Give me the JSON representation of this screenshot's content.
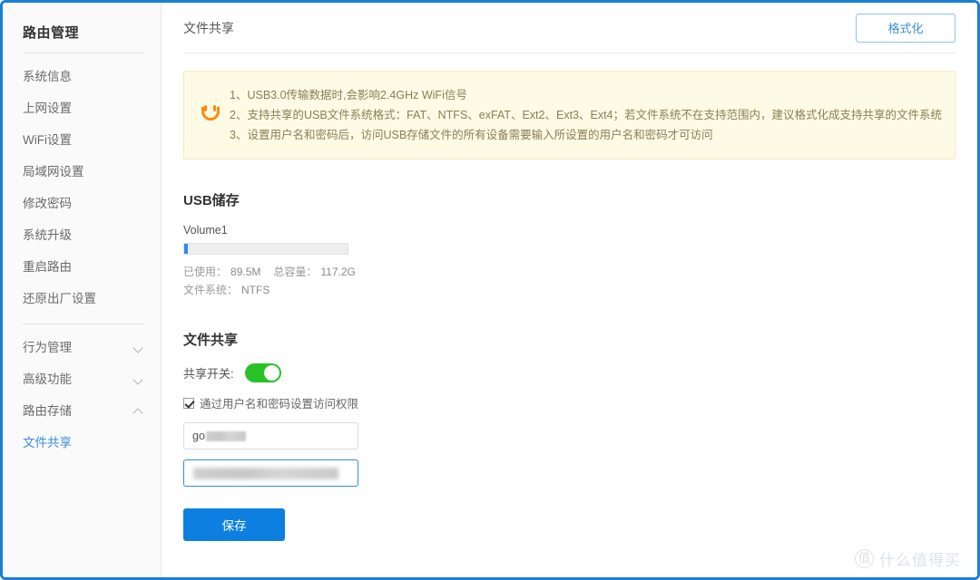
{
  "sidebar": {
    "title": "路由管理",
    "items": [
      {
        "label": "系统信息",
        "type": "link",
        "active": false
      },
      {
        "label": "上网设置",
        "type": "link",
        "active": false
      },
      {
        "label": "WiFi设置",
        "type": "link",
        "active": false
      },
      {
        "label": "局域网设置",
        "type": "link",
        "active": false
      },
      {
        "label": "修改密码",
        "type": "link",
        "active": false
      },
      {
        "label": "系统升级",
        "type": "link",
        "active": false
      },
      {
        "label": "重启路由",
        "type": "link",
        "active": false
      },
      {
        "label": "还原出厂设置",
        "type": "link",
        "active": false
      }
    ],
    "groups": [
      {
        "label": "行为管理",
        "chevron": "chevron-down-icon",
        "expanded": false
      },
      {
        "label": "高级功能",
        "chevron": "chevron-down-icon",
        "expanded": false
      },
      {
        "label": "路由存储",
        "chevron": "chevron-up-icon",
        "expanded": true
      }
    ],
    "sub_items": [
      {
        "label": "文件共享",
        "active": true
      }
    ]
  },
  "header": {
    "title": "文件共享",
    "format_button": "格式化"
  },
  "notice": {
    "icon": "smiley-face-icon",
    "lines": [
      "1、USB3.0传输数据时,会影响2.4GHz WiFi信号",
      "2、支持共享的USB文件系统格式：FAT、NTFS、exFAT、Ext2、Ext3、Ext4；若文件系统不在支持范围内，建议格式化成支持共享的文件系统",
      "3、设置用户名和密码后，访问USB存储文件的所有设备需要输入所设置的用户名和密码才可访问"
    ]
  },
  "usb_storage": {
    "section_title": "USB储存",
    "volume_name": "Volume1",
    "used_label": "已使用：",
    "used_value": "89.5M",
    "total_label": "总容量：",
    "total_value": "117.2G",
    "fs_label": "文件系统：",
    "fs_value": "NTFS",
    "usage_percent": 2
  },
  "file_share": {
    "section_title": "文件共享",
    "switch_label": "共享开关:",
    "switch_on": true,
    "checkbox_label": "通过用户名和密码设置访问权限",
    "checkbox_checked": true,
    "username_value": "go",
    "username_redacted": true,
    "password_value": "",
    "password_redacted": true,
    "password_focused": true,
    "save_button": "保存"
  },
  "watermark": {
    "logo": "值",
    "text": "什么值得买"
  },
  "colors": {
    "accent": "#0d7fe0",
    "link": "#3c8ee0",
    "toggle_on": "#27c327",
    "notice_bg": "#fdfae6",
    "notice_border": "#f4ecc0",
    "notice_text": "#8a7f53",
    "smiley": "#ff8a0d",
    "frame": "#1a7fd4"
  }
}
